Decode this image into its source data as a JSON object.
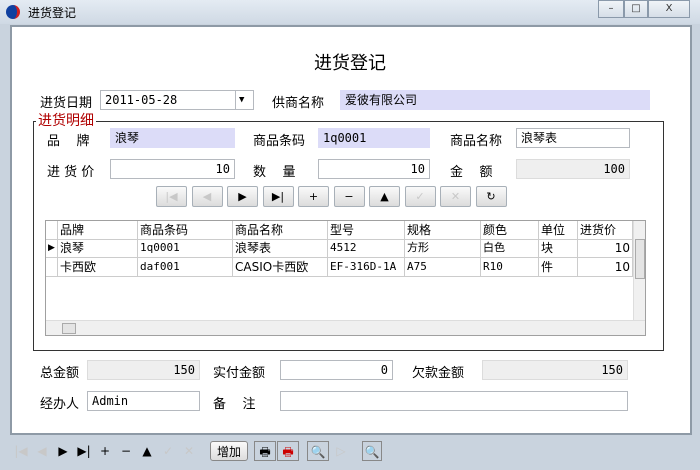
{
  "window": {
    "title": "进货登记",
    "min": "–",
    "max": "□",
    "close": "X"
  },
  "form": {
    "heading": "进货登记",
    "date_label": "进货日期",
    "date_value": "2011-05-28",
    "supplier_label": "供商名称",
    "supplier_value": "爱彼有限公司",
    "group_label": "进货明细",
    "brand_label": "品    牌",
    "brand_value": "浪琴",
    "barcode_label": "商品条码",
    "barcode_value": "1q0001",
    "name_label": "商品名称",
    "name_value": "浪琴表",
    "price_label": "进 货 价",
    "price_value": "10",
    "qty_label": "数    量",
    "qty_value": "10",
    "amount_label": "金    额",
    "amount_value": "100"
  },
  "nav": [
    {
      "icon": "first-icon",
      "glyph": "|◀",
      "enabled": false
    },
    {
      "icon": "prior-icon",
      "glyph": "◀",
      "enabled": false
    },
    {
      "icon": "next-icon",
      "glyph": "▶",
      "enabled": true
    },
    {
      "icon": "last-icon",
      "glyph": "▶|",
      "enabled": true
    },
    {
      "icon": "insert-icon",
      "glyph": "+",
      "enabled": true
    },
    {
      "icon": "delete-icon",
      "glyph": "−",
      "enabled": true
    },
    {
      "icon": "edit-icon",
      "glyph": "▲",
      "enabled": true
    },
    {
      "icon": "post-icon",
      "glyph": "✓",
      "enabled": false
    },
    {
      "icon": "cancel-icon",
      "glyph": "✕",
      "enabled": false
    },
    {
      "icon": "refresh-icon",
      "glyph": "↻",
      "enabled": true
    }
  ],
  "grid": {
    "columns": [
      "品牌",
      "商品条码",
      "商品名称",
      "型号",
      "规格",
      "颜色",
      "单位",
      "进货价"
    ],
    "rows": [
      [
        "浪琴",
        "1q0001",
        "浪琴表",
        "4512",
        "方形",
        "白色",
        "块",
        "10"
      ],
      [
        "卡西欧",
        "daf001",
        "CASIO卡西欧",
        "EF-316D-1A",
        "A75",
        "R10",
        "件",
        "10"
      ]
    ]
  },
  "totals": {
    "total_label": "总金额",
    "total_value": "150",
    "paid_label": "实付金额",
    "paid_value": "0",
    "owed_label": "欠款金额",
    "owed_value": "150",
    "operator_label": "经办人",
    "operator_value": "Admin",
    "remark_label": "备    注",
    "remark_value": ""
  },
  "toolbar": {
    "add_label": "增加"
  },
  "colors": {
    "highlight": "#dcdcf8",
    "legend": "#b00000"
  }
}
